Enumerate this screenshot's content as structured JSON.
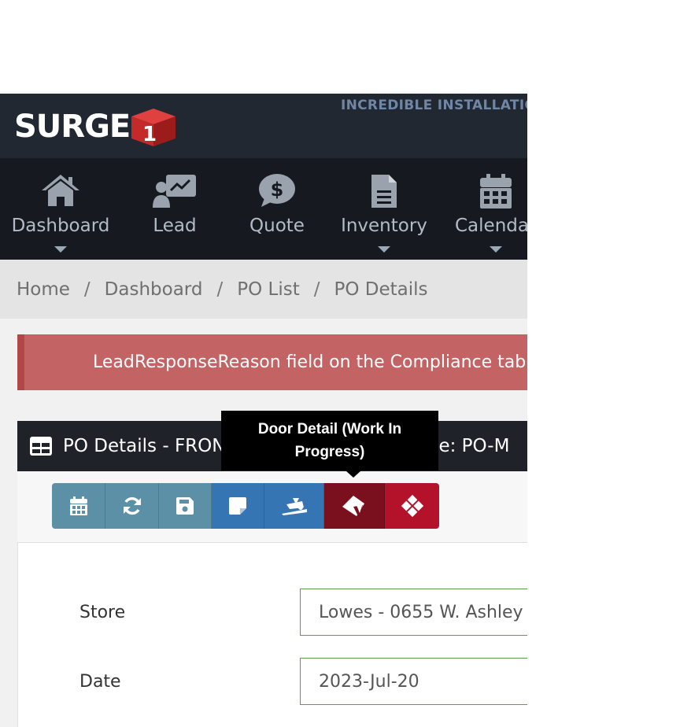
{
  "header": {
    "logo_text": "SURGE",
    "logo_badge": "1",
    "tagline": "INCREDIBLE INSTALLATIONS"
  },
  "nav": {
    "items": [
      {
        "label": "Dashboard",
        "icon": "home-icon",
        "has_dropdown": true
      },
      {
        "label": "Lead",
        "icon": "lead-presentation-icon",
        "has_dropdown": false
      },
      {
        "label": "Quote",
        "icon": "dollar-comment-icon",
        "has_dropdown": false
      },
      {
        "label": "Inventory",
        "icon": "document-icon",
        "has_dropdown": true
      },
      {
        "label": "Calendar",
        "icon": "calendar-icon",
        "has_dropdown": true
      }
    ]
  },
  "breadcrumb": {
    "items": [
      "Home",
      "Dashboard",
      "PO List",
      "PO Details"
    ],
    "separator": "/"
  },
  "alert": {
    "message": "LeadResponseReason field on the Compliance tab is required."
  },
  "panel": {
    "title": "PO Details - FRONT DOOR DETAIL",
    "type_text": "-- Type: PO-M"
  },
  "toolbar": {
    "buttons": [
      {
        "icon": "calendar-icon",
        "color": "#5b90a6"
      },
      {
        "icon": "refresh-icon",
        "color": "#5b90a6"
      },
      {
        "icon": "save-icon",
        "color": "#5b90a6"
      },
      {
        "icon": "sticky-note-icon",
        "color": "#3575b4"
      },
      {
        "icon": "truck-ramp-icon",
        "color": "#3575b4"
      },
      {
        "icon": "door-open-icon",
        "color": "#7a0f1e"
      },
      {
        "icon": "window-icon",
        "color": "#b3122a"
      }
    ],
    "tooltip": {
      "line1": "Door Detail (Work In",
      "line2": "Progress)"
    }
  },
  "form": {
    "store_label": "Store",
    "store_value": "Lowes - 0655 W. Ashley",
    "date_label": "Date",
    "date_value": "2023-Jul-20"
  },
  "colors": {
    "topbar": "#222831",
    "navbar": "#161a20",
    "alert": "#c46363",
    "teal_button": "#5b90a6",
    "blue_button": "#3575b4",
    "red_button": "#b3122a"
  }
}
